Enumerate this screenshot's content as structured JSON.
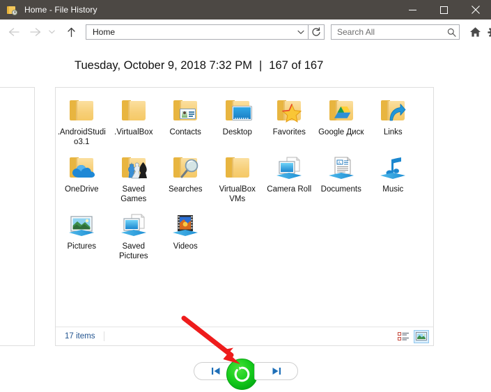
{
  "window": {
    "title": "Home - File History",
    "icon": "folder-history-icon",
    "controls": {
      "minimize": "minimize-button",
      "maximize": "maximize-button",
      "close": "close-button"
    }
  },
  "toolbar": {
    "back": "Back",
    "forward": "Forward",
    "recent": "Recent locations",
    "up": "Up",
    "address_value": "Home",
    "address_placeholder": "",
    "refresh": "Refresh",
    "search_placeholder": "Search All",
    "search_value": "",
    "home_button": "Home",
    "settings_button": "Settings"
  },
  "header": {
    "datetime": "Tuesday, October 9, 2018 7:32 PM",
    "separator": "|",
    "position": "167 of 167"
  },
  "content": {
    "items": [
      {
        "label": ".AndroidStudio3.1",
        "icon": "folder-icon",
        "badge": "none"
      },
      {
        "label": ".VirtualBox",
        "icon": "folder-icon",
        "badge": "none"
      },
      {
        "label": "Contacts",
        "icon": "folder-icon",
        "badge": "contact-card-icon"
      },
      {
        "label": "Desktop",
        "icon": "folder-icon",
        "badge": "monitor-icon"
      },
      {
        "label": "Favorites",
        "icon": "folder-icon",
        "badge": "star-icon"
      },
      {
        "label": "Google Диск",
        "icon": "folder-icon",
        "badge": "google-drive-icon"
      },
      {
        "label": "Links",
        "icon": "folder-icon",
        "badge": "arrow-icon"
      },
      {
        "label": "OneDrive",
        "icon": "folder-icon",
        "badge": "cloud-icon"
      },
      {
        "label": "Saved Games",
        "icon": "folder-icon",
        "badge": "chess-pieces-icon"
      },
      {
        "label": "Searches",
        "icon": "folder-icon",
        "badge": "magnifier-icon"
      },
      {
        "label": "VirtualBox VMs",
        "icon": "folder-icon",
        "badge": "none"
      },
      {
        "label": "Camera Roll",
        "icon": "library-picture-icon",
        "badge": "none"
      },
      {
        "label": "Documents",
        "icon": "library-document-icon",
        "badge": "none"
      },
      {
        "label": "Music",
        "icon": "library-music-icon",
        "badge": "none"
      },
      {
        "label": "Pictures",
        "icon": "library-photo-icon",
        "badge": "none"
      },
      {
        "label": "Saved Pictures",
        "icon": "library-picture-icon",
        "badge": "none"
      },
      {
        "label": "Videos",
        "icon": "library-video-icon",
        "badge": "none"
      }
    ]
  },
  "statusbar": {
    "item_count": "17 items",
    "view_details": "Details view",
    "view_large_icons": "Large icons view"
  },
  "bottom_nav": {
    "previous": "Previous version",
    "restore": "Restore to original location",
    "next": "Next version"
  },
  "annotation": {
    "arrow": "red-pointer-arrow",
    "color": "#ee1c1c"
  },
  "colors": {
    "titlebar": "#4c4844",
    "accent_green": "#18cc1c",
    "status_text": "#21538f",
    "folder_yellow": "#f5c966"
  }
}
